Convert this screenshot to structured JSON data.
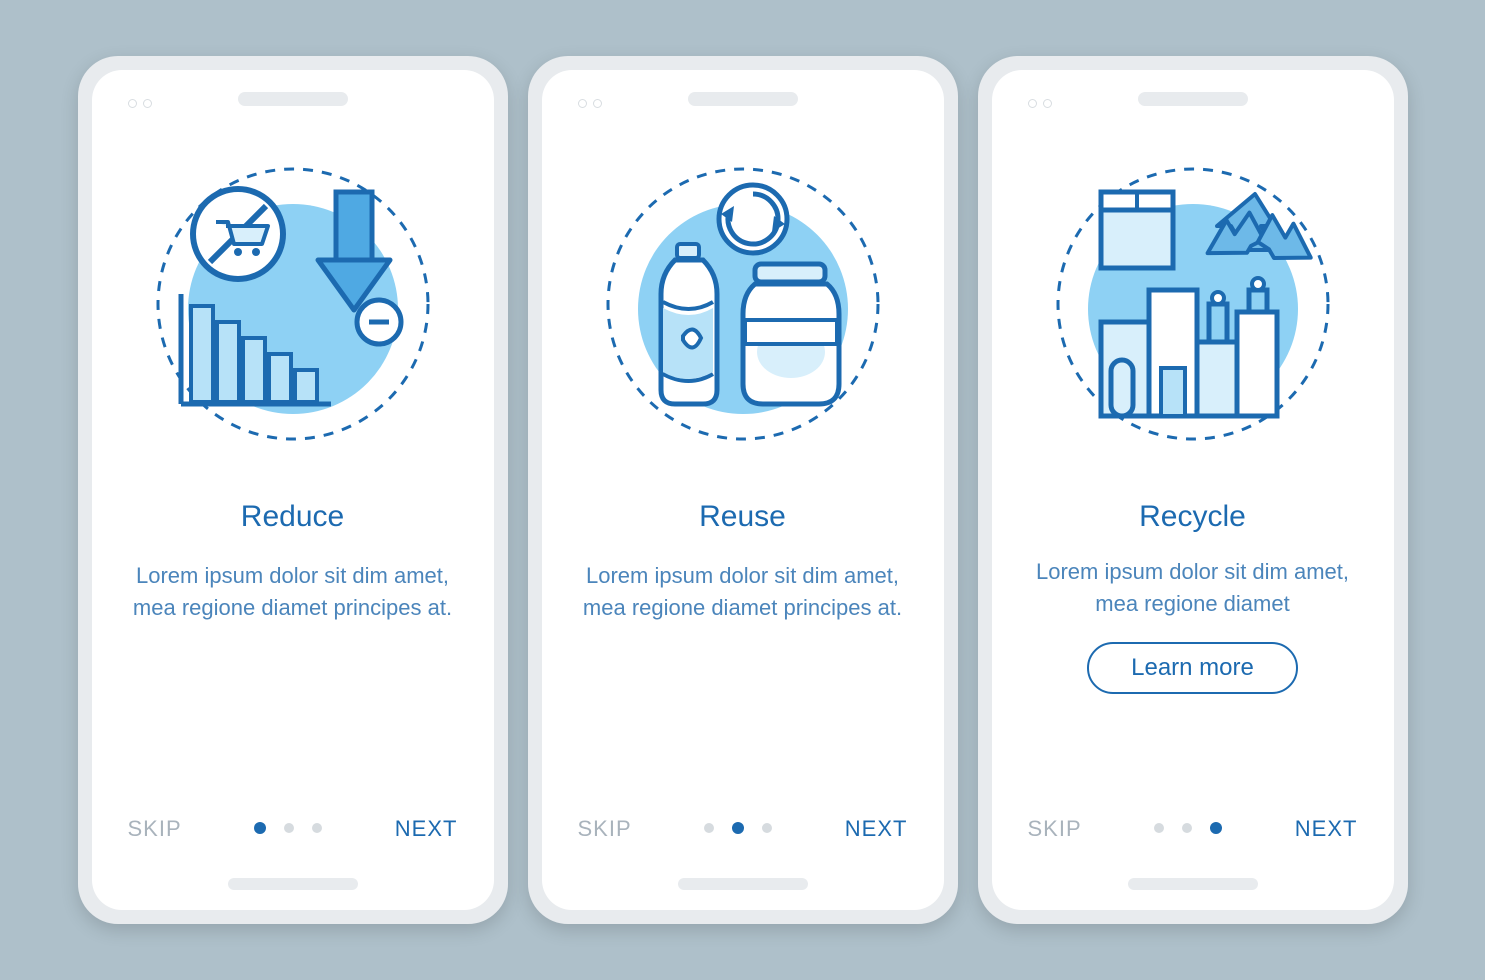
{
  "colors": {
    "accent": "#1C6AB0",
    "muted": "#A9B3BC",
    "textSoft": "#4B85BB"
  },
  "screens": [
    {
      "title": "Reduce",
      "desc": "Lorem ipsum dolor sit dim amet, mea regione diamet principes at.",
      "skip": "SKIP",
      "next": "NEXT",
      "activeDot": 0,
      "icon": "reduce-icon"
    },
    {
      "title": "Reuse",
      "desc": "Lorem ipsum dolor sit dim amet, mea regione diamet principes at.",
      "skip": "SKIP",
      "next": "NEXT",
      "activeDot": 1,
      "icon": "reuse-icon"
    },
    {
      "title": "Recycle",
      "desc": "Lorem ipsum dolor sit dim amet, mea regione diamet",
      "skip": "SKIP",
      "next": "NEXT",
      "learnMore": "Learn more",
      "activeDot": 2,
      "icon": "recycle-icon"
    }
  ]
}
